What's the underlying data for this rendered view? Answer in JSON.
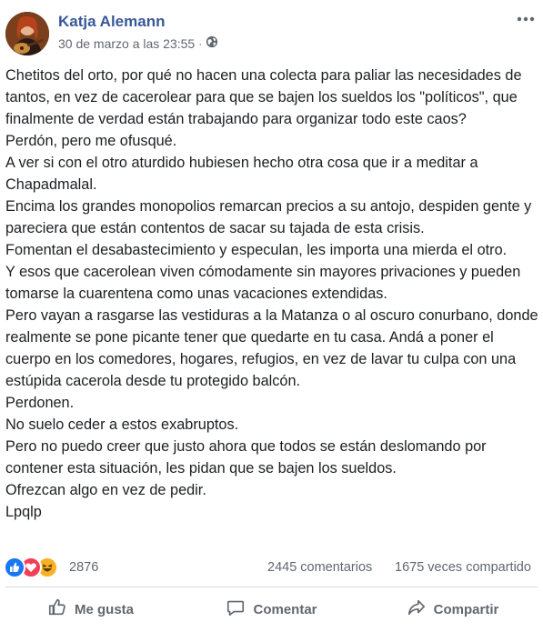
{
  "post": {
    "author": "Katja Alemann",
    "timestamp": "30 de marzo a las 23:55",
    "separator": "·",
    "privacy_icon": "globe-icon",
    "more_icon": "more-options-icon",
    "body": "Chetitos del orto, por qué no hacen una colecta para paliar las necesidades de tantos, en vez de cacerolear para que se bajen los sueldos los \"políticos\", que finalmente de verdad están trabajando para organizar todo este caos?\nPerdón, pero me ofusqué.\nA ver si con el otro aturdido hubiesen hecho otra cosa que ir a meditar a Chapadmalal.\nEncima los grandes monopolios remarcan precios a su antojo, despiden gente y pareciera que están contentos de sacar su tajada de esta crisis.\nFomentan el desabastecimiento y especulan, les importa una mierda el otro.\nY esos que cacerolean viven cómodamente sin mayores privaciones y pueden tomarse la cuarentena como unas vacaciones extendidas.\nPero vayan a rasgarse las vestiduras a la Matanza o al oscuro conurbano, donde realmente se pone picante tener que quedarte en tu casa. Andá a poner el cuerpo en los comedores, hogares, refugios, en vez de lavar tu culpa con una estúpida cacerola desde tu protegido balcón.\nPerdonen.\nNo suelo ceder a estos exabruptos.\nPero no puedo creer que justo ahora que todos se están deslomando por contener esta situación, les pidan que se bajen los sueldos.\nOfrezcan algo en vez de pedir.\nLpqlp"
  },
  "reactions": {
    "icons": [
      "like-icon",
      "love-icon",
      "haha-icon"
    ],
    "count": "2876",
    "comments": "2445 comentarios",
    "shares": "1675 veces compartido"
  },
  "actions": {
    "like_label": "Me gusta",
    "comment_label": "Comentar",
    "share_label": "Compartir"
  },
  "colors": {
    "author": "#385898",
    "like": "#1877f2",
    "love": "#f33e58",
    "haha": "#f7b125"
  }
}
